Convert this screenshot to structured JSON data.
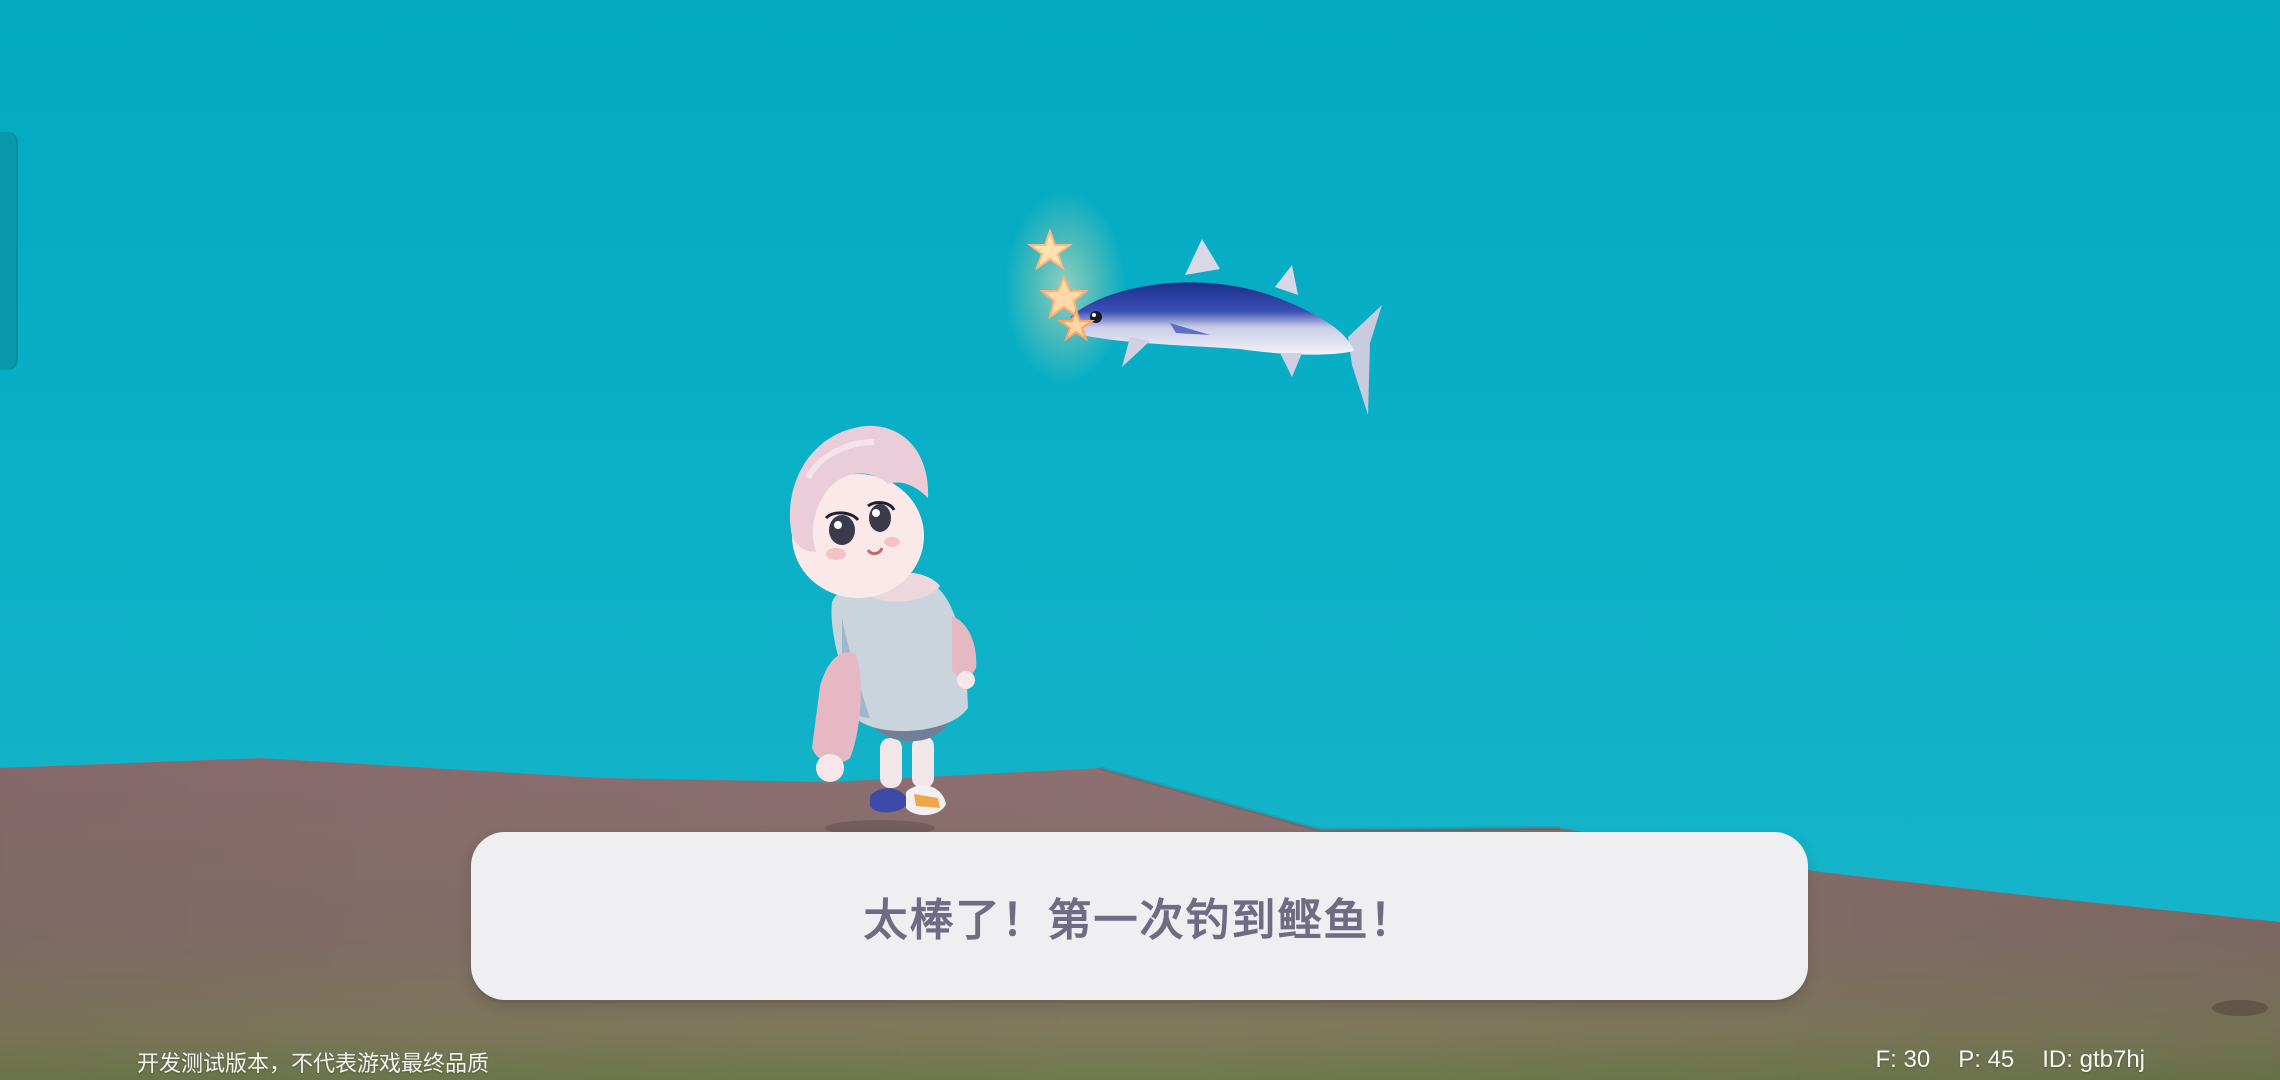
{
  "dialog": {
    "text": "太棒了！第一次钓到鲣鱼！"
  },
  "footer": {
    "dev_note": "开发测试版本，不代表游戏最终品质",
    "fps": "F: 30",
    "ping": "P: 45",
    "id": "ID: gtb7hj"
  },
  "scene": {
    "sky_color": "#02a9c1",
    "ground_color": "#8b6f6f",
    "caught_fish": "bonito-fish",
    "player": "player-character"
  },
  "icons": [
    "star-icon",
    "fish-icon",
    "side-panel-tab"
  ]
}
